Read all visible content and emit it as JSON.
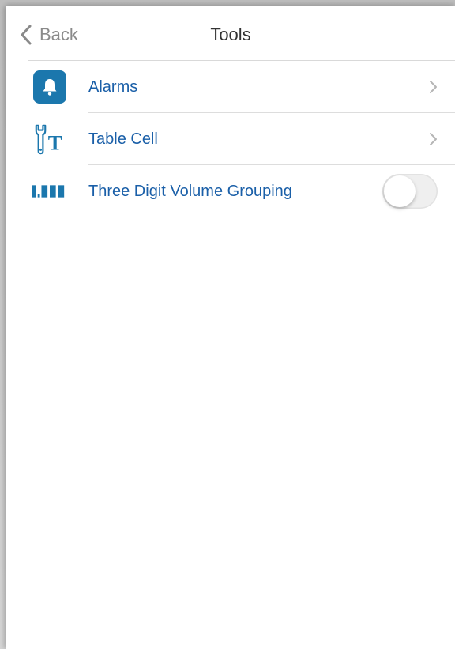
{
  "navbar": {
    "back_label": "Back",
    "title": "Tools"
  },
  "list": {
    "items": [
      {
        "label": "Alarms",
        "icon": "bell-icon",
        "accessory": "chevron"
      },
      {
        "label": "Table Cell",
        "icon": "wrench-t-icon",
        "accessory": "chevron"
      },
      {
        "label": "Three Digit Volume Grouping",
        "icon": "volume-grouping-icon",
        "accessory": "toggle",
        "toggle_on": false
      }
    ]
  },
  "colors": {
    "accent": "#1a5fa8",
    "icon_blue": "#1b77ad",
    "back_gray": "#8a8a8a",
    "title": "#333333"
  }
}
